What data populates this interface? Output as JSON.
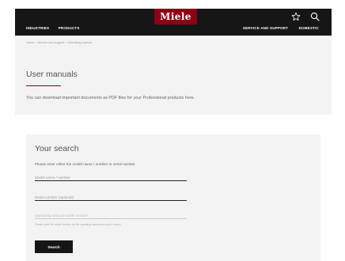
{
  "header": {
    "logo_text": "Miele",
    "brand_color": "#8c0014",
    "nav_left": [
      "INDUSTRIES",
      "PRODUCTS"
    ],
    "nav_right": [
      "SERVICE AND SUPPORT",
      "DOMESTIC"
    ],
    "icons": [
      "star-icon",
      "search-icon"
    ]
  },
  "breadcrumb": "Home > Service and support > Operating manual",
  "page_title": "User manuals",
  "intro_text": "You can download important documents as PDF files for your Professional products here.",
  "search": {
    "title": "Your search",
    "instruction": "Please enter either the model name / number or serial number.",
    "model_placeholder": "Model name / number",
    "serial_placeholder": "Serial number (optional)",
    "manual_placeholder": "Operating manual model number",
    "hint": "Please enter the model number for the operating instructions only if known.",
    "button_label": "Search"
  }
}
